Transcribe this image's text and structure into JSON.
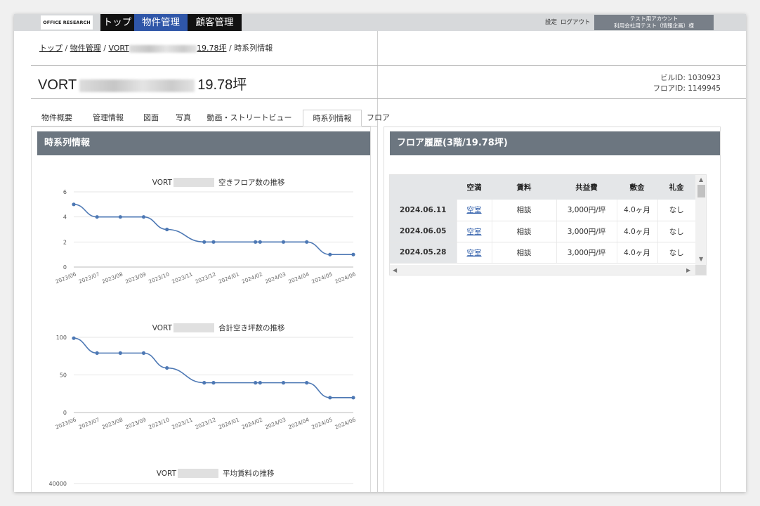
{
  "topbar": {
    "logo": "OFFICE RESEARCH",
    "nav": [
      "トップ",
      "物件管理",
      "顧客管理"
    ],
    "settings": "設定",
    "logout": "ログアウト",
    "account_line1": "テスト用アカウント",
    "account_line2": "利用会社用テスト（情報企画）様"
  },
  "breadcrumb": {
    "top": "トップ",
    "sep": "/",
    "property_mgmt": "物件管理",
    "building_prefix": "VORT",
    "building_suffix": "19.78坪",
    "current": "時系列情報"
  },
  "title": {
    "prefix": "VORT",
    "suffix": "19.78坪"
  },
  "ids": {
    "building_id": "ビルID: 1030923",
    "floor_id": "フロアID: 1149945"
  },
  "tabs": [
    "物件概要",
    "管理情報",
    "図面",
    "写真",
    "動画・ストリートビュー",
    "時系列情報",
    "フロア"
  ],
  "active_tab": "時系列情報",
  "left_section": {
    "title": "時系列情報"
  },
  "right_section": {
    "title": "フロア履歴(3階/19.78坪)"
  },
  "chart_data": [
    {
      "type": "line",
      "title_prefix": "VORT",
      "title_suffix": "空きフロア数の推移",
      "x": [
        "2023/06",
        "2023/07",
        "2023/08",
        "2023/09",
        "2023/10",
        "2023/11",
        "2023/12",
        "2024/01",
        "2024/02",
        "2024/03",
        "2024/04",
        "2024/05",
        "2024/06"
      ],
      "points": [
        [
          0,
          5
        ],
        [
          1,
          4
        ],
        [
          2,
          4
        ],
        [
          3,
          4
        ],
        [
          4,
          3
        ],
        [
          5.6,
          2
        ],
        [
          6,
          2
        ],
        [
          7.8,
          2
        ],
        [
          8,
          2
        ],
        [
          9,
          2
        ],
        [
          10,
          2
        ],
        [
          11,
          1
        ],
        [
          12,
          1
        ]
      ],
      "ylim": [
        0,
        6
      ],
      "yticks": [
        0,
        2,
        4,
        6
      ],
      "color": "#4d78b4"
    },
    {
      "type": "line",
      "title_prefix": "VORT",
      "title_suffix": "合計空き坪数の推移",
      "x": [
        "2023/06",
        "2023/07",
        "2023/08",
        "2023/09",
        "2023/10",
        "2023/11",
        "2023/12",
        "2024/01",
        "2024/02",
        "2024/03",
        "2024/04",
        "2024/05",
        "2024/06"
      ],
      "points": [
        [
          0,
          98.9
        ],
        [
          1,
          79.1
        ],
        [
          2,
          79.1
        ],
        [
          3,
          79.1
        ],
        [
          4,
          59.3
        ],
        [
          5.6,
          39.6
        ],
        [
          6,
          39.6
        ],
        [
          7.8,
          39.6
        ],
        [
          8,
          39.6
        ],
        [
          9,
          39.6
        ],
        [
          10,
          39.6
        ],
        [
          11,
          19.8
        ],
        [
          12,
          19.8
        ]
      ],
      "ylim": [
        0,
        100
      ],
      "yticks": [
        0,
        50,
        100
      ],
      "color": "#4d78b4"
    },
    {
      "type": "line",
      "title_prefix": "VORT",
      "title_suffix": "平均賃料の推移",
      "yticks": [
        40000
      ]
    }
  ],
  "floor_table": {
    "headers": [
      "",
      "空満",
      "賃料",
      "共益費",
      "敷金",
      "礼金"
    ],
    "rows": [
      [
        "2024.06.11",
        "空室",
        "相談",
        "3,000円/坪",
        "4.0ヶ月",
        "なし"
      ],
      [
        "2024.06.05",
        "空室",
        "相談",
        "3,000円/坪",
        "4.0ヶ月",
        "なし"
      ],
      [
        "2024.05.28",
        "空室",
        "相談",
        "3,000円/坪",
        "4.0ヶ月",
        "なし"
      ]
    ]
  }
}
